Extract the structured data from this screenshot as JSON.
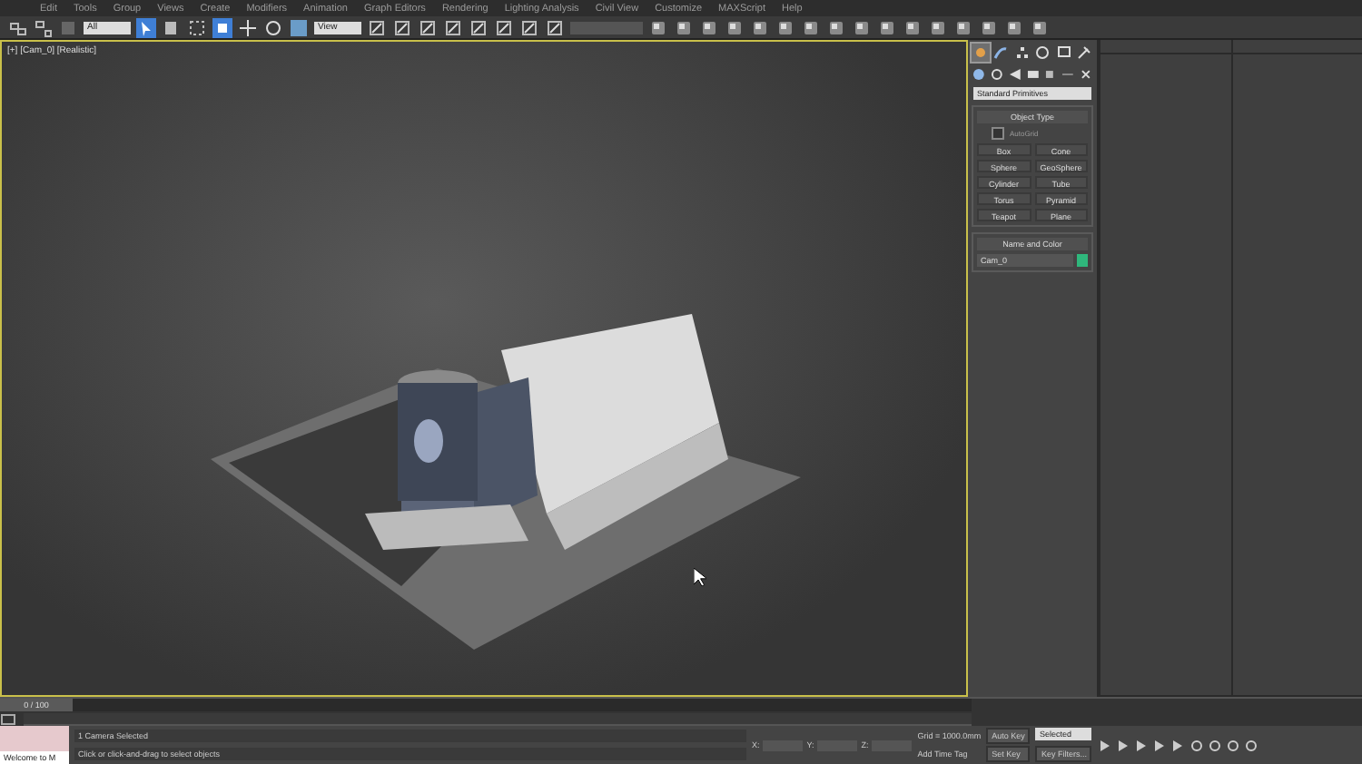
{
  "menu": [
    "Edit",
    "Tools",
    "Group",
    "Views",
    "Create",
    "Modifiers",
    "Animation",
    "Graph Editors",
    "Rendering",
    "Lighting Analysis",
    "Civil View",
    "Customize",
    "MAXScript",
    "Help"
  ],
  "toolbar": {
    "selection_filter": "All",
    "reference_coord": "View"
  },
  "viewport": {
    "label": "[+] [Cam_0] [Realistic]",
    "active": true
  },
  "command_panel": {
    "tabs": [
      {
        "kind": "create",
        "selected": true
      },
      {
        "kind": "modify",
        "selected": false
      },
      {
        "kind": "hierarchy",
        "selected": false
      },
      {
        "kind": "motion",
        "selected": false
      },
      {
        "kind": "display",
        "selected": false
      },
      {
        "kind": "utilities",
        "selected": false
      }
    ],
    "category": "Standard Primitives",
    "object_type": {
      "title": "Object Type",
      "autogrid": {
        "label": "AutoGrid",
        "checked": false
      },
      "buttons": [
        "Box",
        "Cone",
        "Sphere",
        "GeoSphere",
        "Cylinder",
        "Tube",
        "Torus",
        "Pyramid",
        "Teapot",
        "Plane"
      ]
    },
    "name_and_color": {
      "title": "Name and Color",
      "name": "Cam_0",
      "color": "#2fb77c"
    }
  },
  "timeline": {
    "frame": "0 / 100",
    "level": 0
  },
  "status_bar": {
    "welcome": "Welcome to M",
    "selection": "1 Camera Selected",
    "prompt": "Click or click-and-drag to select objects",
    "coords": [
      "X:",
      "Y:",
      "Z:"
    ],
    "grid": "Grid = 1000.0mm",
    "add_time_tag": "Add Time Tag",
    "auto_key": "Auto Key",
    "key_mode": "Selected",
    "set_key": "Set Key",
    "key_filters": "Key Filters..."
  }
}
